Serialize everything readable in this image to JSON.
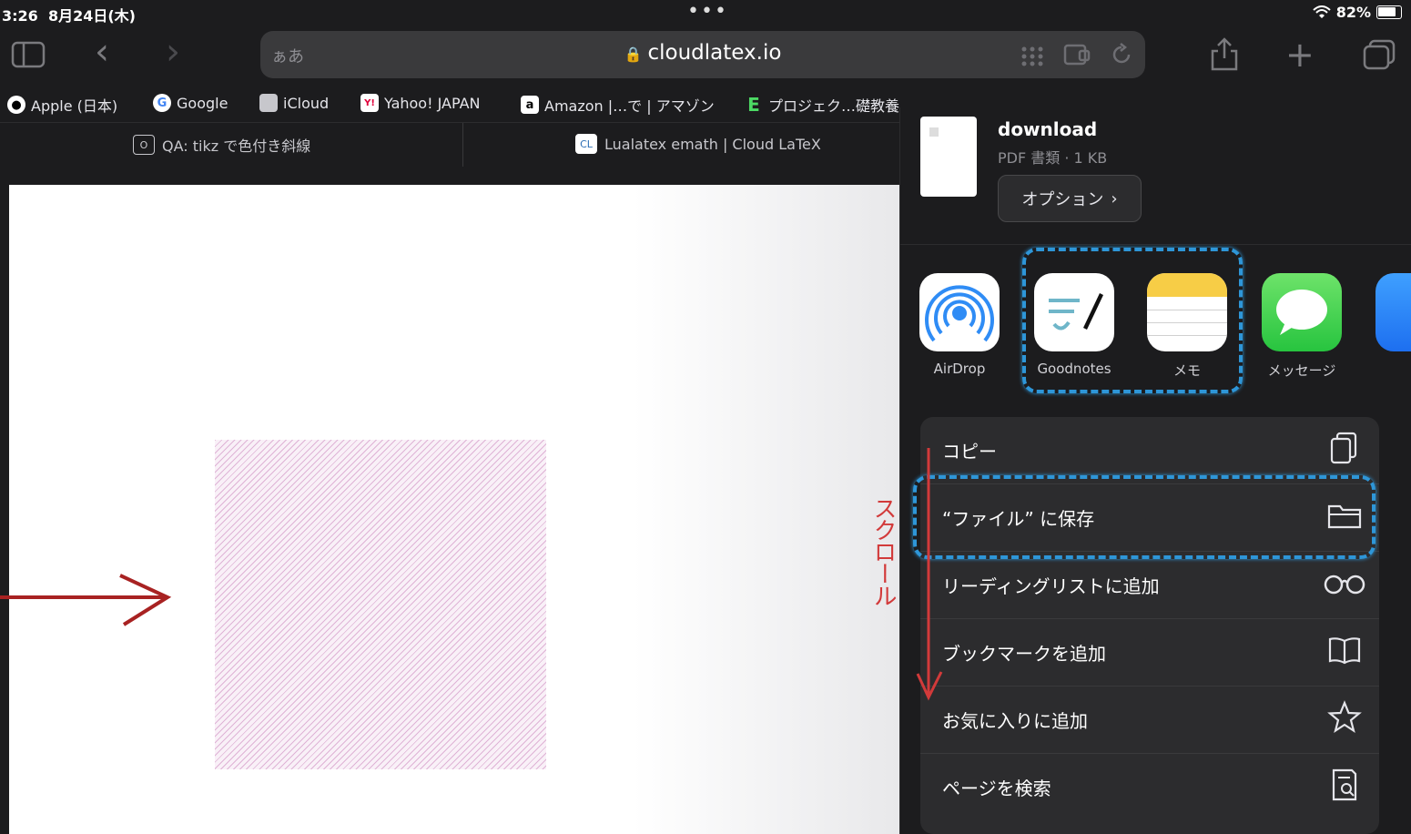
{
  "status": {
    "time": "3:26",
    "date": "8月24日(木)",
    "dots": "•••",
    "battery": "82%"
  },
  "toolbar": {
    "sidebar_icon": "sidebar-icon",
    "back_icon": "‹",
    "forward_icon": "›",
    "address": {
      "aa_label": "ぁあ",
      "url": "cloudlatex.io"
    },
    "share_icon": "share-icon",
    "new_tab_icon": "+",
    "tabs_icon": "tabs-icon"
  },
  "bookmarks": [
    {
      "label": "Apple (日本)",
      "icon": ""
    },
    {
      "label": "Google",
      "icon": "G"
    },
    {
      "label": "iCloud",
      "icon": ""
    },
    {
      "label": "Yahoo! JAPAN",
      "icon": "Y!"
    },
    {
      "label": "Amazon |…で | アマゾン",
      "icon": "a"
    },
    {
      "label": "プロジェク…礎教養",
      "icon": "E"
    }
  ],
  "tabs": [
    {
      "label": "QA: tikz で色付き斜線",
      "icon": "O"
    },
    {
      "label": "Lualatex emath | Cloud LaTeX",
      "icon": "CL"
    }
  ],
  "share_sheet": {
    "doc_name": "download",
    "doc_meta": "PDF 書類 · 1 KB",
    "options_label": "オプション",
    "apps": [
      {
        "label": "AirDrop"
      },
      {
        "label": "Goodnotes"
      },
      {
        "label": "メモ"
      },
      {
        "label": "メッセージ"
      }
    ],
    "actions": [
      {
        "label": "コピー"
      },
      {
        "label": "“ファイル” に保存"
      },
      {
        "label": "リーディングリストに追加"
      },
      {
        "label": "ブックマークを追加"
      },
      {
        "label": "お気に入りに追加"
      },
      {
        "label": "ページを検索"
      }
    ]
  },
  "annotation": {
    "scroll_text": "スクロール",
    "color": "#d23a3a",
    "highlight_color": "#2e96d8"
  }
}
